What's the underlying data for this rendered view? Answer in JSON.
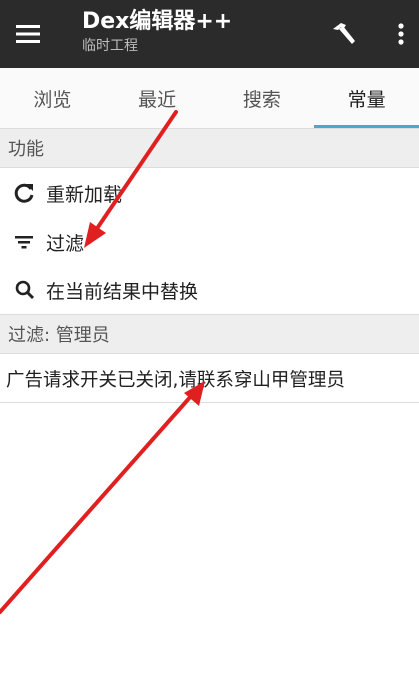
{
  "toolbar": {
    "title": "Dex编辑器++",
    "subtitle": "临时工程",
    "menu_icon": "hamburger-menu-icon",
    "build_icon": "hammer-icon",
    "overflow_icon": "more-vert-icon",
    "background_color": "#2b2b2b"
  },
  "tabs": [
    {
      "label": "浏览",
      "active": false
    },
    {
      "label": "最近",
      "active": false
    },
    {
      "label": "搜索",
      "active": false
    },
    {
      "label": "常量",
      "active": true
    }
  ],
  "accent_color": "#4da6d8",
  "functions_section": {
    "header": "功能",
    "items": [
      {
        "label": "重新加载",
        "icon": "refresh-icon"
      },
      {
        "label": "过滤",
        "icon": "filter-icon"
      },
      {
        "label": "在当前结果中替换",
        "icon": "search-replace-icon"
      }
    ]
  },
  "filter_section": {
    "header": "过滤: 管理员",
    "results": [
      "广告请求开关已关闭,请联系穿山甲管理员"
    ]
  },
  "annotation_color": "#e02020"
}
